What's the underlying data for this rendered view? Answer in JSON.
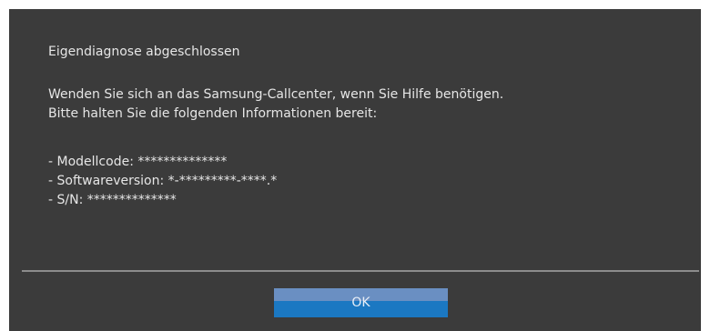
{
  "dialog": {
    "title": "Eigendiagnose abgeschlossen",
    "message_lines": [
      "Wenden Sie sich an das Samsung-Callcenter, wenn Sie Hilfe benötigen.",
      "Bitte halten Sie die folgenden Informationen bereit:"
    ],
    "info_lines": [
      "- Modellcode: **************",
      "- Softwareversion: *-*********-****.*",
      "- S/N: **************"
    ],
    "ok_label": "OK"
  },
  "colors": {
    "dialog_background": "#3b3b3b",
    "text": "#e6e6e6",
    "divider": "#8c8c8c",
    "button_top": "#6a8fc2",
    "button_bottom": "#1b78c2"
  }
}
